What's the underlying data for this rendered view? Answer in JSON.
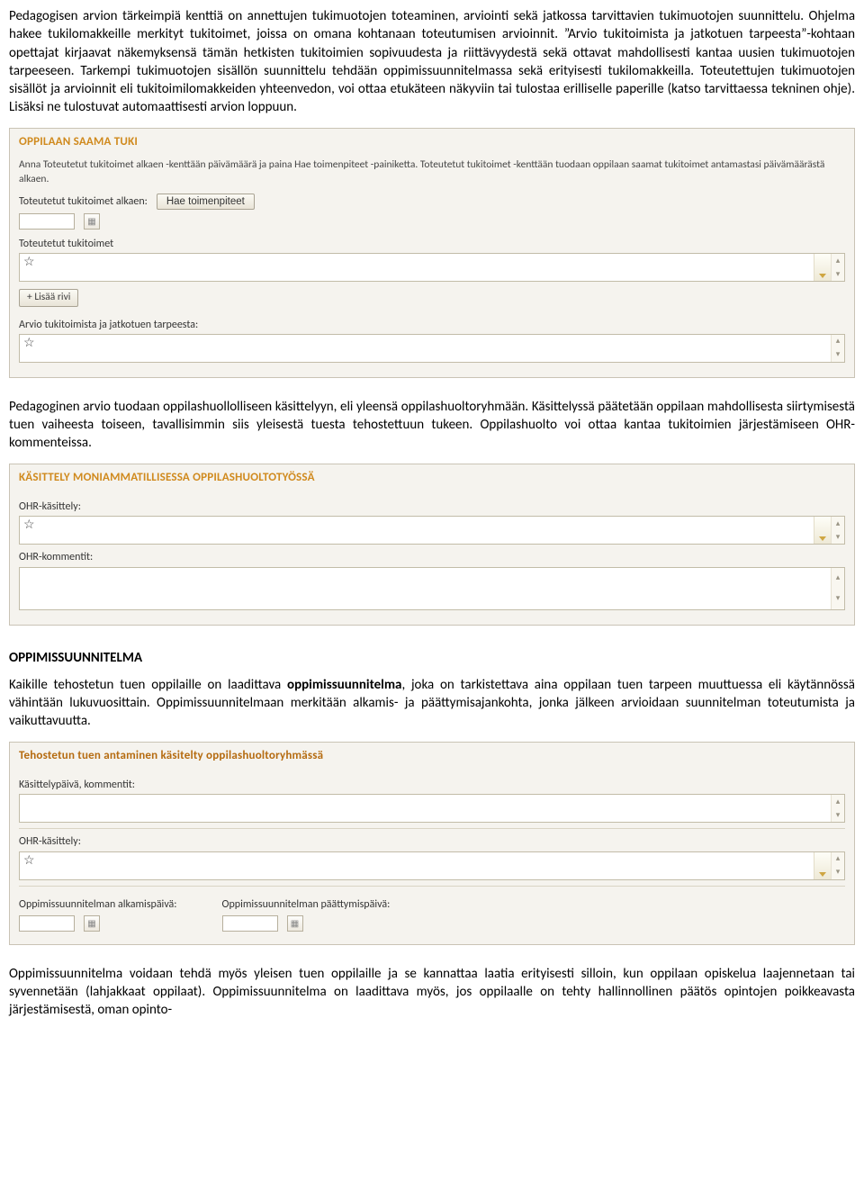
{
  "para1": "Pedagogisen arvion tärkeimpiä kenttiä on annettujen tukimuotojen toteaminen, arviointi sekä jatkossa tarvittavien tukimuotojen suunnittelu. Ohjelma hakee tukilomakkeille merkityt tukitoimet, joissa on omana kohtanaan toteutumisen arvioinnit. ”Arvio tukitoimista ja jatkotuen tarpeesta”-kohtaan opettajat kirjaavat näkemyksensä tämän hetkisten tukitoimien sopivuudesta ja riittävyydestä sekä ottavat mahdollisesti kantaa uusien tukimuotojen tarpeeseen. Tarkempi tukimuotojen sisällön suunnittelu tehdään oppimissuunnitelmassa sekä erityisesti tukilomakkeilla. Toteutettujen tukimuotojen sisällöt ja arvioinnit eli tukitoimilomakkeiden yhteenvedon, voi ottaa etukäteen näkyviin tai tulostaa erilliselle paperille (katso tarvittaessa tekninen ohje). Lisäksi ne tulostuvat automaattisesti arvion loppuun.",
  "panel1": {
    "title": "OPPILAAN SAAMA TUKI",
    "help": "Anna Toteutetut tukitoimet alkaen -kenttään päivämäärä ja paina Hae toimenpiteet -painiketta. Toteutetut tukitoimet -kenttään tuodaan oppilaan saamat tukitoimet antamastasi päivämäärästä alkaen.",
    "start_label": "Toteutetut tukitoimet alkaen:",
    "fetch_btn": "Hae toimenpiteet",
    "done_label": "Toteutetut tukitoimet",
    "add_row": "+ Lisää rivi",
    "eval_label": "Arvio tukitoimista ja jatkotuen tarpeesta:"
  },
  "para2": "Pedagoginen arvio tuodaan oppilashuollolliseen käsittelyyn, eli yleensä oppilashuoltoryhmään. Käsittelyssä päätetään oppilaan mahdollisesta siirtymisestä tuen vaiheesta toiseen, tavallisimmin siis yleisestä tuesta tehostettuun tukeen. Oppilashuolto voi ottaa kantaa tukitoimien järjestämiseen OHR-kommenteissa.",
  "panel2": {
    "title": "KÄSITTELY MONIAMMATILLISESSA OPPILASHUOLTOTYÖSSÄ",
    "ohr_label": "OHR-käsittely:",
    "comments_label": "OHR-kommentit:"
  },
  "heading": "OPPIMISSUUNNITELMA",
  "para3_prefix": "Kaikille tehostetun tuen oppilaille on laadittava ",
  "para3_bold": "oppimissuunnitelma",
  "para3_rest": ", joka on tarkistettava aina oppilaan tuen tarpeen muuttuessa eli käytännössä vähintään lukuvuosittain. Oppimissuunnitelmaan merkitään alkamis- ja päättymisajankohta, jonka jälkeen arvioidaan suunnitelman toteutumista ja vaikuttavuutta.",
  "panel3": {
    "title": "Tehostetun tuen antaminen käsitelty oppilashuoltoryhmässä",
    "day_label": "Käsittelypäivä, kommentit:",
    "ohr_label": "OHR-käsittely:",
    "start_label": "Oppimissuunnitelman alkamispäivä:",
    "end_label": "Oppimissuunnitelman päättymispäivä:"
  },
  "para4": "Oppimissuunnitelma voidaan tehdä myös yleisen tuen oppilaille ja se kannattaa laatia erityisesti silloin, kun oppilaan opiskelua laajennetaan tai syvennetään (lahjakkaat oppilaat). Oppimissuunnitelma on laadittava myös, jos oppilaalle on tehty hallinnollinen päätös opintojen poikkeavasta järjestämisestä, oman opinto-"
}
